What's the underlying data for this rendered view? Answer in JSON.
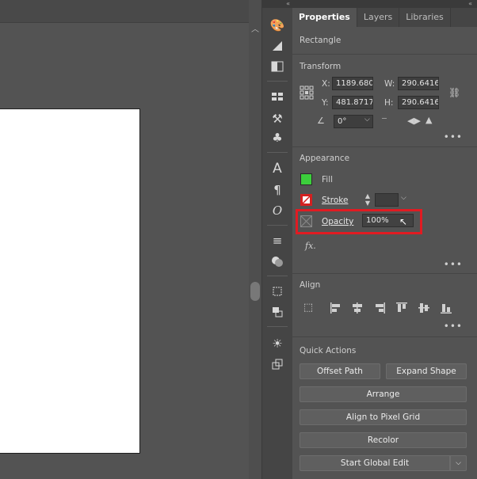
{
  "panel": {
    "tabs": [
      {
        "label": "Properties",
        "active": true
      },
      {
        "label": "Layers",
        "active": false
      },
      {
        "label": "Libraries",
        "active": false
      }
    ],
    "object_type": "Rectangle",
    "transform": {
      "title": "Transform",
      "x_label": "X:",
      "x_value": "1189.6803",
      "y_label": "Y:",
      "y_value": "481.8717",
      "w_label": "W:",
      "w_value": "290.6416",
      "h_label": "H:",
      "h_value": "290.6416",
      "rotate_value": "0°"
    },
    "appearance": {
      "title": "Appearance",
      "fill_label": "Fill",
      "fill_color": "#3ccf3c",
      "stroke_label": "Stroke",
      "opacity_label": "Opacity",
      "opacity_value": "100%",
      "fx_label": "fx."
    },
    "align": {
      "title": "Align"
    },
    "quick_actions": {
      "title": "Quick Actions",
      "offset_path": "Offset Path",
      "expand_shape": "Expand Shape",
      "arrange": "Arrange",
      "align_pixel_grid": "Align to Pixel Grid",
      "recolor": "Recolor",
      "start_global_edit": "Start Global Edit"
    },
    "more_dots": "•••"
  },
  "highlight_color": "#e11b22",
  "toolstrip_icons": [
    "brush-libraries-icon",
    "gradient-icon",
    "transparency-icon",
    "swatches-icon",
    "brushes-icon",
    "symbols-icon",
    "character-icon",
    "paragraph-icon",
    "opentype-icon",
    "stroke-panel-icon",
    "pathfinder-icon",
    "transform-panel-icon",
    "align-panel-icon",
    "appearance-panel-icon",
    "asset-export-icon"
  ]
}
